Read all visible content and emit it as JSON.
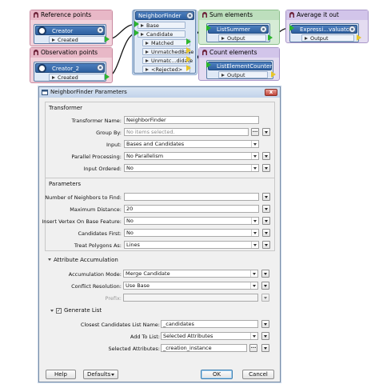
{
  "canvas": {
    "bookmarks": {
      "reference": "Reference points",
      "observation": "Observation points",
      "sum": "Sum elements",
      "count": "Count elements",
      "average": "Average it out"
    },
    "creator1": {
      "name": "Creator",
      "port": "Created"
    },
    "creator2": {
      "name": "Creator_2",
      "port": "Created"
    },
    "neighborfinder": {
      "name": "NeighborFinder",
      "inputs": [
        "Base",
        "Candidate"
      ],
      "outputs": [
        "Matched",
        "UnmatchedBase",
        "Unmatc...didate",
        "<Rejected>"
      ]
    },
    "listsummer": {
      "name": "ListSummer",
      "port": "Output"
    },
    "listcounter": {
      "name": "ListElementCounter",
      "port": "Output"
    },
    "evaluator": {
      "name": "Expressi...valuator",
      "port": "Output"
    }
  },
  "dialog": {
    "title": "NeighborFinder Parameters",
    "close": "x",
    "transformer": {
      "group": "Transformer",
      "name_label": "Transformer Name:",
      "name_value": "NeighborFinder",
      "groupby_label": "Group By:",
      "groupby_placeholder": "No items selected.",
      "input_label": "Input:",
      "input_value": "Bases and Candidates",
      "parallel_label": "Parallel Processing:",
      "parallel_value": "No Parallelism",
      "ordered_label": "Input Ordered:",
      "ordered_value": "No"
    },
    "parameters": {
      "group": "Parameters",
      "neighbors_label": "Number of Neighbors to Find:",
      "neighbors_value": "",
      "maxdist_label": "Maximum Distance:",
      "maxdist_value": "20",
      "vertex_label": "Insert Vertex On Base Feature:",
      "vertex_value": "No",
      "candfirst_label": "Candidates First:",
      "candfirst_value": "No",
      "polygons_label": "Treat Polygons As:",
      "polygons_value": "Lines"
    },
    "accumulation": {
      "group": "Attribute Accumulation",
      "mode_label": "Accumulation Mode:",
      "mode_value": "Merge Candidate",
      "conflict_label": "Conflict Resolution:",
      "conflict_value": "Use Base",
      "prefix_label": "Prefix:",
      "prefix_value": ""
    },
    "generate_list": {
      "label": "Generate List",
      "checked": true,
      "listname_label": "Closest Candidates List Name:",
      "listname_value": "_candidates",
      "addto_label": "Add To List:",
      "addto_value": "Selected Attributes",
      "selattr_label": "Selected Attributes:",
      "selattr_value": "_creation_instance"
    },
    "buttons": {
      "help": "Help",
      "defaults": "Defaults",
      "ok": "OK",
      "cancel": "Cancel"
    },
    "ellipsis": "..."
  },
  "colors": {
    "bookmark_pink": "#f2d3dc",
    "bookmark_green": "#d6ecd6",
    "bookmark_purple": "#e4dcf1",
    "bookmark_blue": "#d4e3f3",
    "transformer_fill": "#dfe9f6",
    "connection": "#111111",
    "port_green": "#2db52d",
    "port_yellow": "#e8c62a"
  }
}
